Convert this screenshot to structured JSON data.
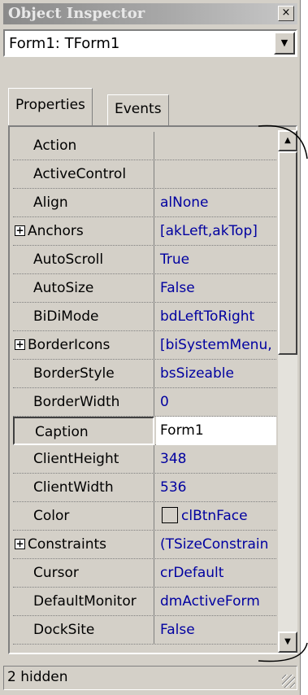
{
  "window": {
    "title": "Object Inspector",
    "close_glyph": "×"
  },
  "object_selector": {
    "value": "Form1: TForm1",
    "arrow_glyph": "▼"
  },
  "tabs": [
    {
      "label": "Properties",
      "active": true
    },
    {
      "label": "Events",
      "active": false
    }
  ],
  "properties": [
    {
      "name": "Action",
      "value": "",
      "expandable": false
    },
    {
      "name": "ActiveControl",
      "value": "",
      "expandable": false
    },
    {
      "name": "Align",
      "value": "alNone",
      "expandable": false
    },
    {
      "name": "Anchors",
      "value": "[akLeft,akTop]",
      "expandable": true
    },
    {
      "name": "AutoScroll",
      "value": "True",
      "expandable": false
    },
    {
      "name": "AutoSize",
      "value": "False",
      "expandable": false
    },
    {
      "name": "BiDiMode",
      "value": "bdLeftToRight",
      "expandable": false
    },
    {
      "name": "BorderIcons",
      "value": "[biSystemMenu,",
      "expandable": true
    },
    {
      "name": "BorderStyle",
      "value": "bsSizeable",
      "expandable": false
    },
    {
      "name": "BorderWidth",
      "value": "0",
      "expandable": false
    },
    {
      "name": "Caption",
      "value": "Form1",
      "expandable": false,
      "selected": true
    },
    {
      "name": "ClientHeight",
      "value": "348",
      "expandable": false
    },
    {
      "name": "ClientWidth",
      "value": "536",
      "expandable": false
    },
    {
      "name": "Color",
      "value": "clBtnFace",
      "expandable": false,
      "swatch": "#d4d0c8"
    },
    {
      "name": "Constraints",
      "value": "(TSizeConstrain",
      "expandable": true
    },
    {
      "name": "Cursor",
      "value": "crDefault",
      "expandable": false
    },
    {
      "name": "DefaultMonitor",
      "value": "dmActiveForm",
      "expandable": false
    },
    {
      "name": "DockSite",
      "value": "False",
      "expandable": false
    }
  ],
  "plus_glyph": "+",
  "scrollbar": {
    "up_glyph": "▲",
    "down_glyph": "▼",
    "position": 0.0
  },
  "status": {
    "text": "2 hidden"
  },
  "colors": {
    "face": "#d4d0c8",
    "value_text": "#0000a0",
    "title_gradient_start": "#8a8a8a"
  }
}
